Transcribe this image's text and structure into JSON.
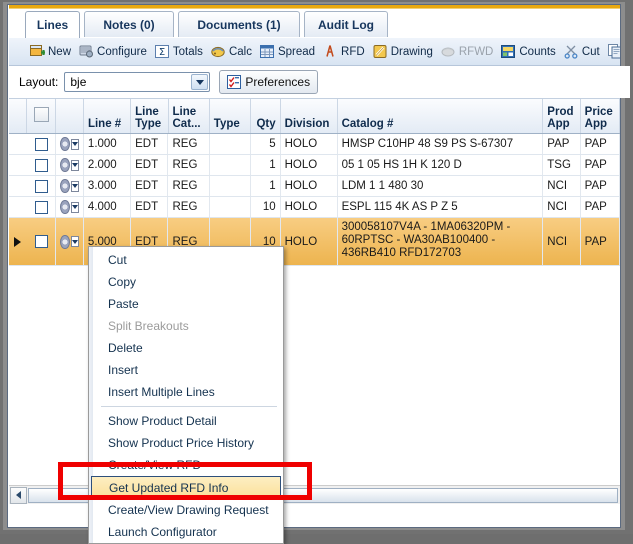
{
  "tabs": [
    {
      "label": "Lines",
      "active": true
    },
    {
      "label": "Notes (0)",
      "active": false
    },
    {
      "label": "Documents (1)",
      "active": false
    },
    {
      "label": "Audit Log",
      "active": false
    }
  ],
  "toolbar": {
    "items": [
      {
        "label": "New",
        "icon": "new-grid-icon",
        "disabled": false
      },
      {
        "label": "Configure",
        "icon": "configure-icon",
        "disabled": false
      },
      {
        "label": "Totals",
        "icon": "sigma-icon",
        "disabled": false
      },
      {
        "label": "Calc",
        "icon": "calc-icon",
        "disabled": false
      },
      {
        "label": "Spread",
        "icon": "spread-icon",
        "disabled": false
      },
      {
        "label": "RFD",
        "icon": "rfd-icon",
        "disabled": false
      },
      {
        "label": "Drawing",
        "icon": "drawing-icon",
        "disabled": false
      },
      {
        "label": "RFWD",
        "icon": "rfwd-icon",
        "disabled": true
      },
      {
        "label": "Counts",
        "icon": "counts-icon",
        "disabled": false
      },
      {
        "label": "Cut",
        "icon": "scissors-icon",
        "disabled": false
      },
      {
        "label": "Copy",
        "icon": "copy-icon",
        "disabled": false
      }
    ]
  },
  "layout_bar": {
    "label": "Layout:",
    "value": "bje",
    "preferences_label": "Preferences"
  },
  "grid": {
    "headers": [
      "Line #",
      "Line Type",
      "Line Cat...",
      "Type",
      "Qty",
      "Division",
      "Catalog #",
      "Prod App",
      "Price App"
    ],
    "rows": [
      {
        "line": "1.000",
        "line_type": "EDT",
        "line_cat": "REG",
        "type": "",
        "qty": "5",
        "division": "HOLO",
        "catalog": "HMSP C10HP 48 S9 PS S-67307",
        "prod_app": "PAP",
        "price_app": "PAP",
        "selected": false
      },
      {
        "line": "2.000",
        "line_type": "EDT",
        "line_cat": "REG",
        "type": "",
        "qty": "1",
        "division": "HOLO",
        "catalog": "05 1 05 HS 1H K 120 D",
        "prod_app": "TSG",
        "price_app": "PAP",
        "selected": false
      },
      {
        "line": "3.000",
        "line_type": "EDT",
        "line_cat": "REG",
        "type": "",
        "qty": "1",
        "division": "HOLO",
        "catalog": "LDM 1 1 480 30",
        "prod_app": "NCI",
        "price_app": "PAP",
        "selected": false
      },
      {
        "line": "4.000",
        "line_type": "EDT",
        "line_cat": "REG",
        "type": "",
        "qty": "10",
        "division": "HOLO",
        "catalog": "ESPL 115 4K AS P Z 5",
        "prod_app": "NCI",
        "price_app": "PAP",
        "selected": false
      },
      {
        "line": "5.000",
        "line_type": "EDT",
        "line_cat": "REG",
        "type": "",
        "qty": "10",
        "division": "HOLO",
        "catalog": "300058107V4A - 1MA06320PM -\n60RPTSC - WA30AB100400 -\n436RB410  RFD172703",
        "prod_app": "NCI",
        "price_app": "PAP",
        "selected": true
      }
    ]
  },
  "context_menu": {
    "items": [
      {
        "label": "Cut",
        "disabled": false,
        "highlight": false,
        "separator_after": false
      },
      {
        "label": "Copy",
        "disabled": false,
        "highlight": false,
        "separator_after": false
      },
      {
        "label": "Paste",
        "disabled": false,
        "highlight": false,
        "separator_after": false
      },
      {
        "label": "Split Breakouts",
        "disabled": true,
        "highlight": false,
        "separator_after": false
      },
      {
        "label": "Delete",
        "disabled": false,
        "highlight": false,
        "separator_after": false
      },
      {
        "label": "Insert",
        "disabled": false,
        "highlight": false,
        "separator_after": false
      },
      {
        "label": "Insert Multiple Lines",
        "disabled": false,
        "highlight": false,
        "separator_after": true
      },
      {
        "label": "Show Product Detail",
        "disabled": false,
        "highlight": false,
        "separator_after": false
      },
      {
        "label": "Show Product Price History",
        "disabled": false,
        "highlight": false,
        "separator_after": false
      },
      {
        "label": "Create/View RFD",
        "disabled": false,
        "highlight": false,
        "separator_after": false
      },
      {
        "label": "Get Updated RFD Info",
        "disabled": false,
        "highlight": true,
        "separator_after": false
      },
      {
        "label": "Create/View Drawing Request",
        "disabled": false,
        "highlight": false,
        "separator_after": false
      },
      {
        "label": "Launch Configurator",
        "disabled": false,
        "highlight": false,
        "separator_after": false
      }
    ]
  },
  "colors": {
    "selected_row": "#edb44f",
    "annotation": "#ef0000",
    "menu_highlight": "#fbe09a",
    "tab_text": "#17365d"
  }
}
